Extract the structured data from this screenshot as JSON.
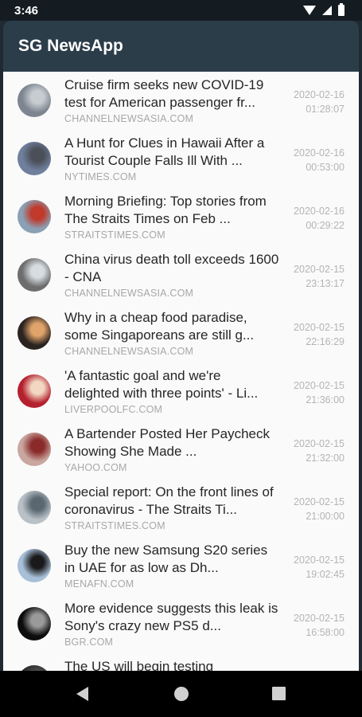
{
  "status": {
    "time": "3:46"
  },
  "app_bar": {
    "title": "SG NewsApp"
  },
  "articles": [
    {
      "headline": "Cruise firm seeks new COVID-19 test for American passenger fr...",
      "source": "CHANNELNEWSASIA.COM",
      "date": "2020-02-16",
      "time": "01:28:07",
      "thumb_bg": "#7d8590",
      "thumb_fg": "#c7ccd1"
    },
    {
      "headline": "A Hunt for Clues in Hawaii After a Tourist Couple Falls Ill With ...",
      "source": "NYTIMES.COM",
      "date": "2020-02-16",
      "time": "00:53:00",
      "thumb_bg": "#6f7f9c",
      "thumb_fg": "#4a4f58"
    },
    {
      "headline": "Morning Briefing: Top stories from The Straits Times on Feb ...",
      "source": "STRAITSTIMES.COM",
      "date": "2020-02-16",
      "time": "00:29:22",
      "thumb_bg": "#8aa0b4",
      "thumb_fg": "#c0392b"
    },
    {
      "headline": "China virus death toll exceeds 1600 - CNA",
      "source": "CHANNELNEWSASIA.COM",
      "date": "2020-02-15",
      "time": "23:13:17",
      "thumb_bg": "#6d6d6d",
      "thumb_fg": "#d6dde0"
    },
    {
      "headline": "Why in a cheap food paradise, some Singaporeans are still g...",
      "source": "CHANNELNEWSASIA.COM",
      "date": "2020-02-15",
      "time": "22:16:29",
      "thumb_bg": "#2a2320",
      "thumb_fg": "#e0a36a"
    },
    {
      "headline": "'A fantastic goal and we're delighted with three points' - Li...",
      "source": "LIVERPOOLFC.COM",
      "date": "2020-02-15",
      "time": "21:36:00",
      "thumb_bg": "#b5202e",
      "thumb_fg": "#f2d8c2"
    },
    {
      "headline": "A Bartender Posted Her Paycheck Showing She Made ...",
      "source": "YAHOO.COM",
      "date": "2020-02-15",
      "time": "21:32:00",
      "thumb_bg": "#c9a7a0",
      "thumb_fg": "#8a2a2a"
    },
    {
      "headline": "Special report: On the front lines of coronavirus - The Straits Ti...",
      "source": "STRAITSTIMES.COM",
      "date": "2020-02-15",
      "time": "21:00:00",
      "thumb_bg": "#b9c1c7",
      "thumb_fg": "#5a6770"
    },
    {
      "headline": "Buy the new Samsung S20 series in UAE for as low as Dh...",
      "source": "MENAFN.COM",
      "date": "2020-02-15",
      "time": "19:02:45",
      "thumb_bg": "#a7c0d8",
      "thumb_fg": "#1a1a1a"
    },
    {
      "headline": "More evidence suggests this leak is Sony's crazy new PS5 d...",
      "source": "BGR.COM",
      "date": "2020-02-15",
      "time": "16:58:00",
      "thumb_bg": "#0c0c0c",
      "thumb_fg": "#9a9a9a"
    },
    {
      "headline": "The US will begin testing",
      "source": "",
      "date": "",
      "time": "",
      "thumb_bg": "#2a2a2a",
      "thumb_fg": "#555555"
    }
  ]
}
